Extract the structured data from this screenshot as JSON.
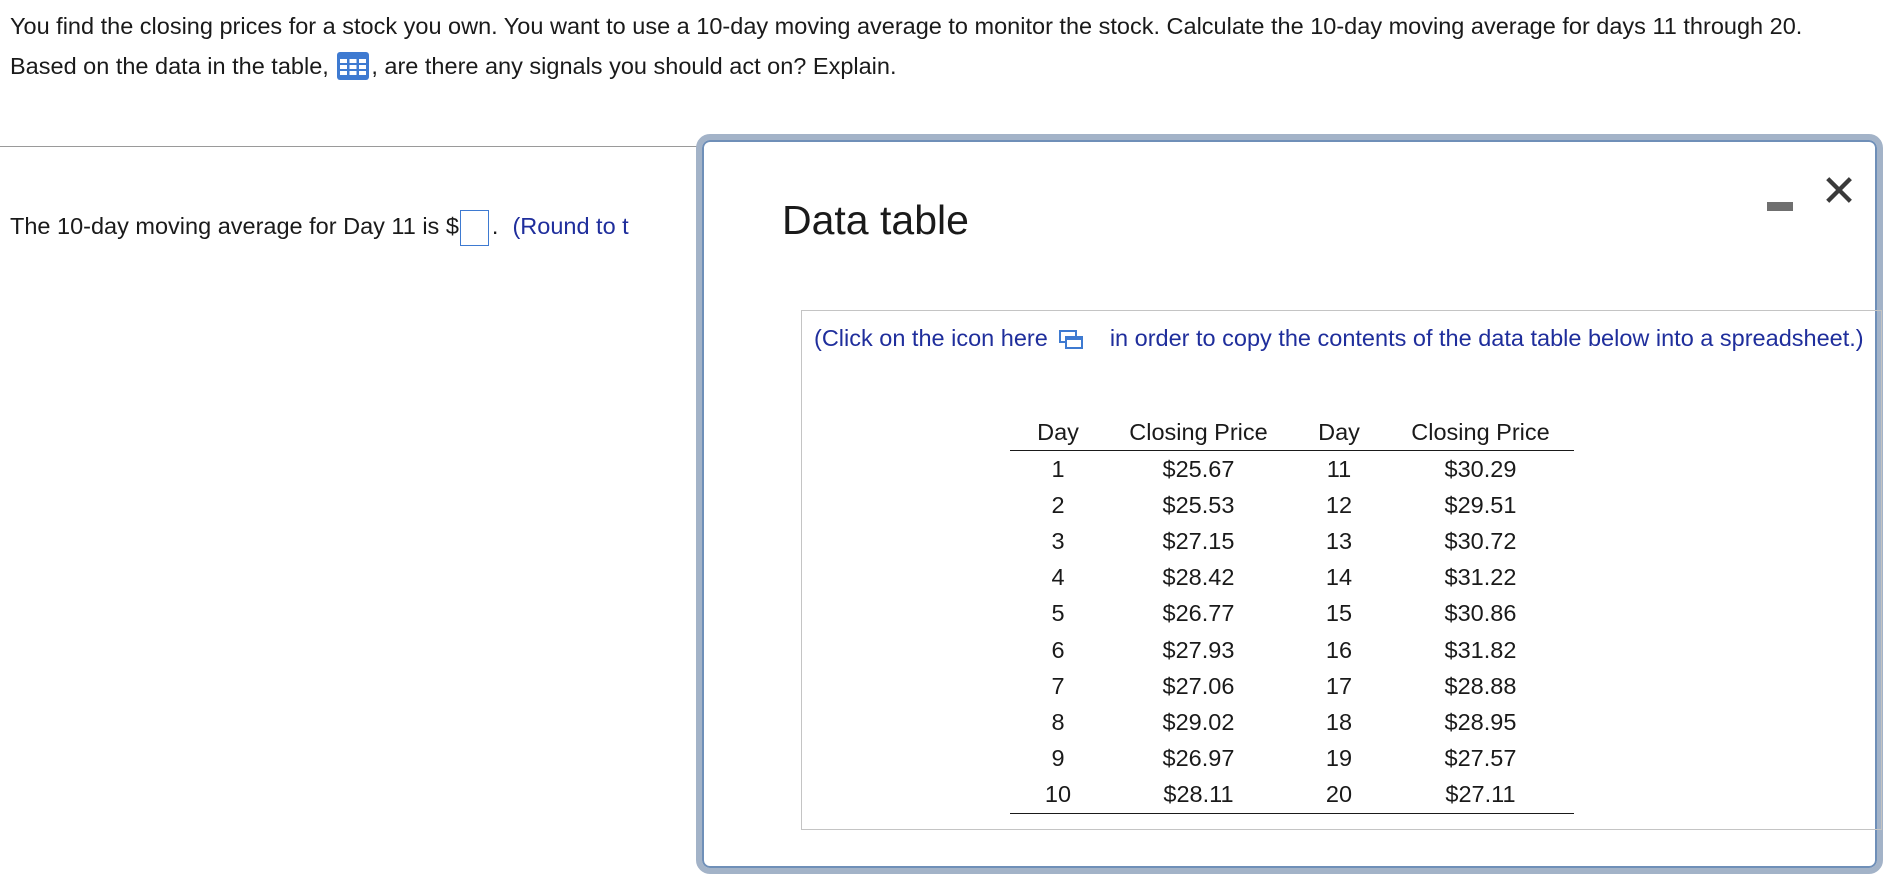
{
  "question": {
    "text_before_icon": "You find the closing prices for a stock you own. You want to use a 10-day moving average to monitor the stock. Calculate the 10-day moving average for days 11 through 20. Based on the data in the table,",
    "text_after_icon": ", are there any signals you should act on? Explain.",
    "table_icon": "data-table-grid-icon"
  },
  "answer": {
    "prefix": "The 10-day moving average for Day 11 is $",
    "input_value": "",
    "suffix": ".",
    "round_note": "(Round to t"
  },
  "modal": {
    "title": "Data table",
    "minimize_icon": "minimize-icon",
    "close_icon": "close-icon",
    "close_glyph": "✕",
    "copy_note_before": "(Click on the icon here",
    "copy_note_after": "in order to copy the contents of the data table below into a spreadsheet.)",
    "copy_icon": "copy-to-spreadsheet-icon",
    "table": {
      "headers": [
        "Day",
        "Closing Price",
        "Day",
        "Closing Price"
      ],
      "rows": [
        [
          "1",
          "$25.67",
          "11",
          "$30.29"
        ],
        [
          "2",
          "$25.53",
          "12",
          "$29.51"
        ],
        [
          "3",
          "$27.15",
          "13",
          "$30.72"
        ],
        [
          "4",
          "$28.42",
          "14",
          "$31.22"
        ],
        [
          "5",
          "$26.77",
          "15",
          "$30.86"
        ],
        [
          "6",
          "$27.93",
          "16",
          "$31.82"
        ],
        [
          "7",
          "$27.06",
          "17",
          "$28.88"
        ],
        [
          "8",
          "$29.02",
          "18",
          "$28.95"
        ],
        [
          "9",
          "$26.97",
          "19",
          "$27.57"
        ],
        [
          "10",
          "$28.11",
          "20",
          "$27.11"
        ]
      ]
    }
  },
  "colors": {
    "link_blue": "#1f2e9c",
    "input_border": "#3e7ad1",
    "icon_blue": "#3e7ad1",
    "modal_border": "#a3b3c8"
  }
}
